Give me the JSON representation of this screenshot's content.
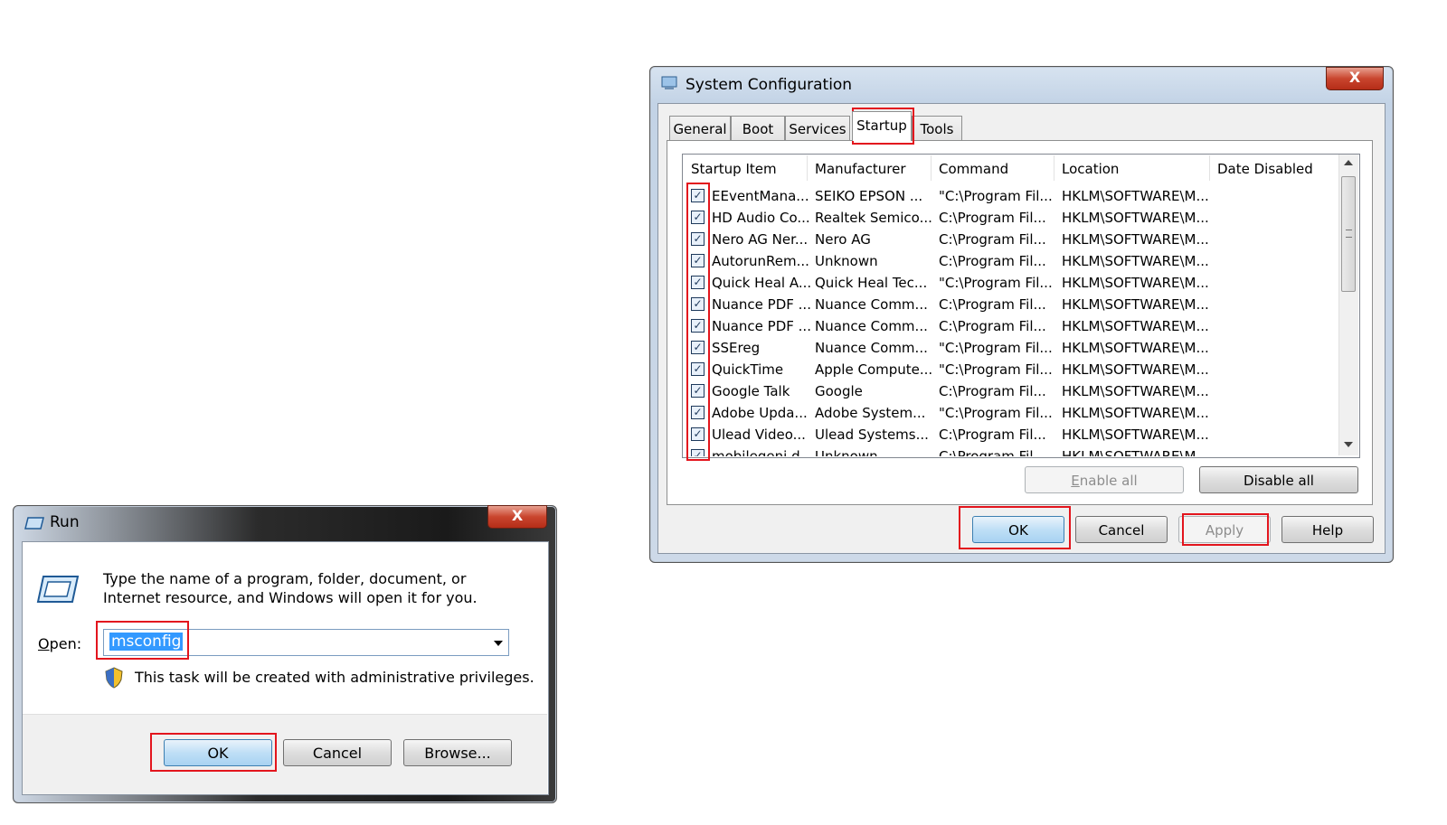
{
  "sysconfig": {
    "title": "System Configuration",
    "close": "X",
    "tabs": [
      "General",
      "Boot",
      "Services",
      "Startup",
      "Tools"
    ],
    "columns": [
      "Startup Item",
      "Manufacturer",
      "Command",
      "Location",
      "Date Disabled"
    ],
    "rows": [
      {
        "item": "EEventMana...",
        "manufacturer": "SEIKO EPSON ...",
        "command": "\"C:\\Program Fil...",
        "location": "HKLM\\SOFTWARE\\M..."
      },
      {
        "item": "HD Audio Co...",
        "manufacturer": "Realtek Semico...",
        "command": "C:\\Program Fil...",
        "location": "HKLM\\SOFTWARE\\M..."
      },
      {
        "item": "Nero AG Ner...",
        "manufacturer": "Nero AG",
        "command": "C:\\Program Fil...",
        "location": "HKLM\\SOFTWARE\\M..."
      },
      {
        "item": "AutorunRem...",
        "manufacturer": "Unknown",
        "command": "C:\\Program Fil...",
        "location": "HKLM\\SOFTWARE\\M..."
      },
      {
        "item": "Quick Heal A...",
        "manufacturer": "Quick Heal Tec...",
        "command": "\"C:\\Program Fil...",
        "location": "HKLM\\SOFTWARE\\M..."
      },
      {
        "item": "Nuance PDF ...",
        "manufacturer": "Nuance Comm...",
        "command": "C:\\Program Fil...",
        "location": "HKLM\\SOFTWARE\\M..."
      },
      {
        "item": "Nuance PDF ...",
        "manufacturer": "Nuance Comm...",
        "command": "C:\\Program Fil...",
        "location": "HKLM\\SOFTWARE\\M..."
      },
      {
        "item": "SSEreg",
        "manufacturer": "Nuance Comm...",
        "command": "\"C:\\Program Fil...",
        "location": "HKLM\\SOFTWARE\\M..."
      },
      {
        "item": "QuickTime",
        "manufacturer": "Apple Compute...",
        "command": "\"C:\\Program Fil...",
        "location": "HKLM\\SOFTWARE\\M..."
      },
      {
        "item": "Google Talk",
        "manufacturer": "Google",
        "command": "C:\\Program Fil...",
        "location": "HKLM\\SOFTWARE\\M..."
      },
      {
        "item": "Adobe Upda...",
        "manufacturer": "Adobe System...",
        "command": "\"C:\\Program Fil...",
        "location": "HKLM\\SOFTWARE\\M..."
      },
      {
        "item": "Ulead Video...",
        "manufacturer": "Ulead Systems...",
        "command": "C:\\Program Fil...",
        "location": "HKLM\\SOFTWARE\\M..."
      },
      {
        "item": "mobilegeni d...",
        "manufacturer": "Unknown",
        "command": "C:\\Program Fil...",
        "location": "HKLM\\SOFTWARE\\M..."
      }
    ],
    "checkmark": "✓",
    "enable_all": "Enable all",
    "disable_all": "Disable all",
    "ok": "OK",
    "cancel": "Cancel",
    "apply": "Apply",
    "help": "Help"
  },
  "run": {
    "title": "Run",
    "close": "X",
    "description": "Type the name of a program, folder, document, or Internet resource, and Windows will open it for you.",
    "open_label": "Open:",
    "open_value": "msconfig",
    "admin_note": "This task will be created with administrative privileges.",
    "ok": "OK",
    "cancel": "Cancel",
    "browse": "Browse..."
  }
}
